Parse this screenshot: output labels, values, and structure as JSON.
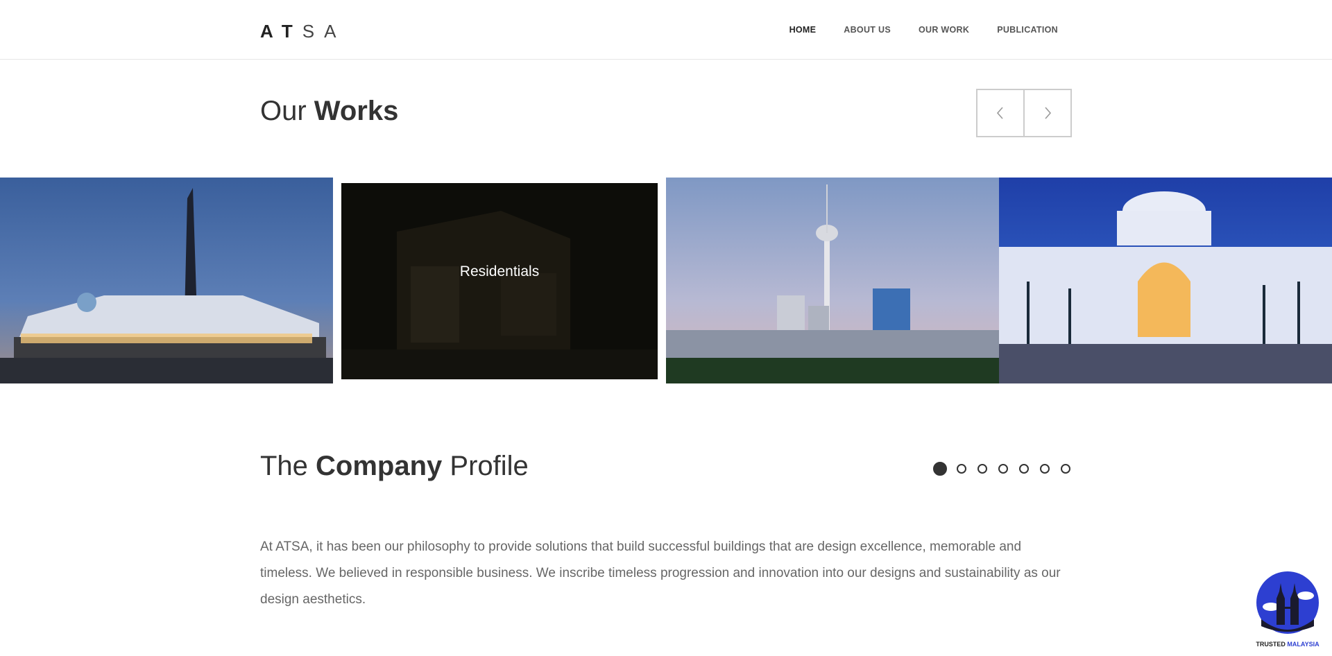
{
  "header": {
    "logo": {
      "bold1": "A",
      "bold2": "T",
      "light1": "S",
      "light2": "A"
    },
    "nav": [
      {
        "label": "HOME",
        "active": true
      },
      {
        "label": "ABOUT US",
        "active": false
      },
      {
        "label": "OUR WORK",
        "active": false
      },
      {
        "label": "PUBLICATION",
        "active": false
      }
    ]
  },
  "works": {
    "title_light": "Our ",
    "title_bold": "Works",
    "prev_icon": "chevron-left-icon",
    "next_icon": "chevron-right-icon",
    "slides": [
      {
        "caption": ""
      },
      {
        "caption": "Residentials"
      },
      {
        "caption": ""
      },
      {
        "caption": ""
      }
    ]
  },
  "profile": {
    "title_light1": "The ",
    "title_bold": "Company",
    "title_light2": " Profile",
    "dots_count": 7,
    "active_dot": 0,
    "text": "At ATSA, it has been our philosophy to provide solutions that build successful buildings that are design excellence, memorable and timeless. We believed in responsible business. We inscribe timeless progression and innovation into our designs and sustainability as our design aesthetics."
  },
  "badge": {
    "label_1": "TRUSTED ",
    "label_2": "MALAYSIA"
  },
  "colors": {
    "text_dark": "#333333",
    "text_muted": "#666666",
    "badge_blue": "#2d3fd1"
  }
}
